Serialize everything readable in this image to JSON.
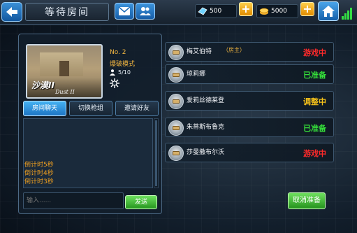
{
  "header": {
    "title": "等待房间",
    "coins_value": "500",
    "gold_value": "5000"
  },
  "room": {
    "map_name_cn": "沙漠II",
    "map_name_en": "Dust II",
    "number": "No. 2",
    "mode": "爆破模式",
    "players_count": "5/10"
  },
  "tabs": [
    {
      "label": "房间聊天",
      "active": true
    },
    {
      "label": "切换枪组",
      "active": false
    },
    {
      "label": "邀请好友",
      "active": false
    }
  ],
  "chat": {
    "messages": [
      "倒计时5秒",
      "倒计时4秒",
      "倒计时3秒"
    ],
    "input_placeholder": "输入......",
    "send_label": "发送"
  },
  "players": [
    {
      "name": "梅艾伯特",
      "tag": "（房主）",
      "status": "游戏中",
      "status_color": "#ff2a2a"
    },
    {
      "name": "琼莉娜",
      "tag": "",
      "status": "已准备",
      "status_color": "#35e03a"
    },
    {
      "name": "爱莉丝德莱登",
      "tag": "",
      "status": "调整中",
      "status_color": "#f5c11a"
    },
    {
      "name": "朱蒂斯布鲁克",
      "tag": "",
      "status": "已准备",
      "status_color": "#35e03a"
    },
    {
      "name": "莎曼撒布尔沃",
      "tag": "",
      "status": "游戏中",
      "status_color": "#ff2a2a"
    }
  ],
  "actions": {
    "cancel_ready_label": "取消准备"
  },
  "colors": {
    "accent_blue": "#1d74c4",
    "action_green": "#25961e",
    "highlight_orange": "#f2b640"
  }
}
